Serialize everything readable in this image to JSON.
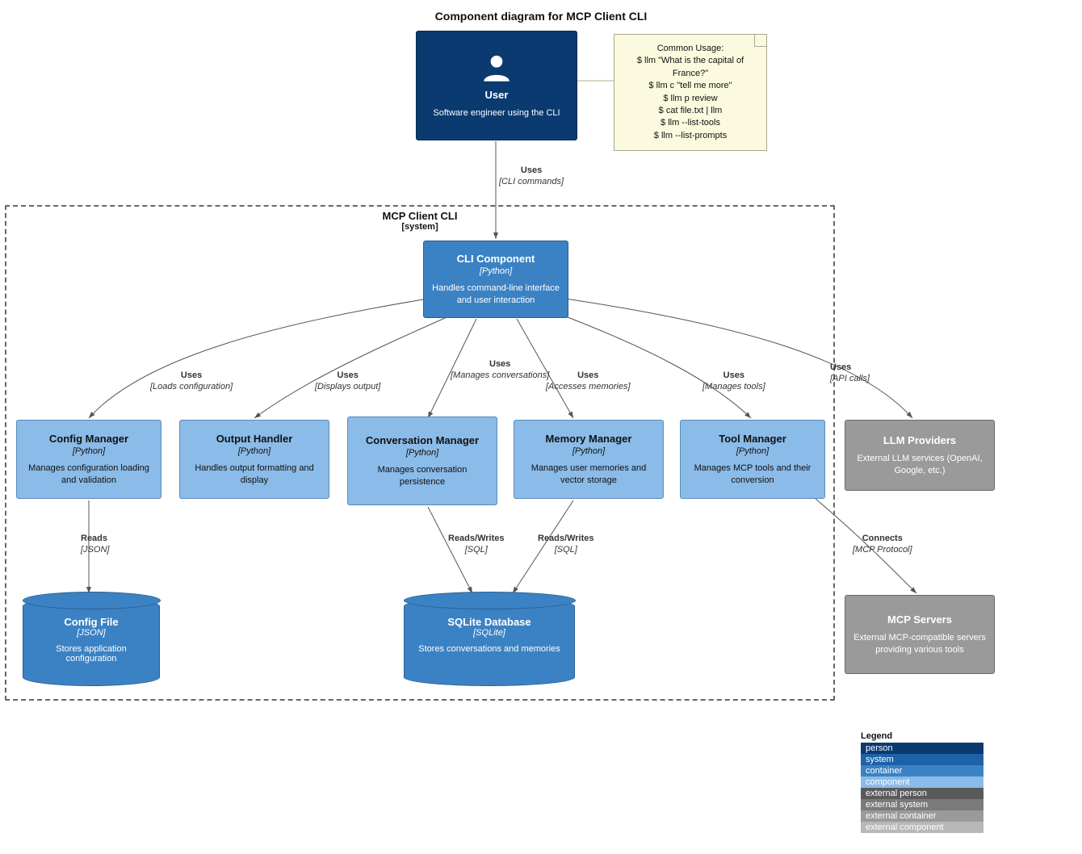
{
  "title": "Component diagram for MCP Client CLI",
  "user": {
    "name": "User",
    "desc": "Software engineer using the CLI"
  },
  "note": {
    "lines": [
      "Common Usage:",
      "$ llm \"What is the capital of France?\"",
      "$ llm c \"tell me more\"",
      "$ llm p review",
      "$ cat file.txt | llm",
      "$ llm --list-tools",
      "$ llm --list-prompts"
    ]
  },
  "system": {
    "name": "MCP Client CLI",
    "sub": "[system]"
  },
  "cli": {
    "name": "CLI Component",
    "tech": "[Python]",
    "desc": "Handles command-line interface and user interaction"
  },
  "config": {
    "name": "Config Manager",
    "tech": "[Python]",
    "desc": "Manages configuration loading and validation"
  },
  "output": {
    "name": "Output Handler",
    "tech": "[Python]",
    "desc": "Handles output formatting and display"
  },
  "conv": {
    "name": "Conversation Manager",
    "tech": "[Python]",
    "desc": "Manages conversation persistence"
  },
  "mem": {
    "name": "Memory Manager",
    "tech": "[Python]",
    "desc": "Manages user memories and vector storage"
  },
  "tool": {
    "name": "Tool Manager",
    "tech": "[Python]",
    "desc": "Manages MCP tools and their conversion"
  },
  "llm": {
    "name": "LLM Providers",
    "desc": "External LLM services (OpenAI, Google, etc.)"
  },
  "mcp": {
    "name": "MCP Servers",
    "desc": "External MCP-compatible servers providing various tools"
  },
  "cfgfile": {
    "name": "Config File",
    "tech": "[JSON]",
    "desc": "Stores application configuration"
  },
  "sqlite": {
    "name": "SQLite Database",
    "tech": "[SQLite]",
    "desc": "Stores conversations and memories"
  },
  "edges": {
    "user_cli": {
      "t1": "Uses",
      "t2": "[CLI commands]"
    },
    "cli_config": {
      "t1": "Uses",
      "t2": "[Loads configuration]"
    },
    "cli_output": {
      "t1": "Uses",
      "t2": "[Displays output]"
    },
    "cli_conv": {
      "t1": "Uses",
      "t2": "[Manages conversations]"
    },
    "cli_mem": {
      "t1": "Uses",
      "t2": "[Accesses memories]"
    },
    "cli_tool": {
      "t1": "Uses",
      "t2": "[Manages tools]"
    },
    "cli_llm": {
      "t1": "Uses",
      "t2": "[API calls]"
    },
    "cfg_file": {
      "t1": "Reads",
      "t2": "[JSON]"
    },
    "conv_db": {
      "t1": "Reads/Writes",
      "t2": "[SQL]"
    },
    "mem_db": {
      "t1": "Reads/Writes",
      "t2": "[SQL]"
    },
    "tool_mcp": {
      "t1": "Connects",
      "t2": "[MCP Protocol]"
    }
  },
  "legend": {
    "title": "Legend",
    "items": [
      "person",
      "system",
      "container",
      "component",
      "external person",
      "external system",
      "external container",
      "external component"
    ]
  }
}
